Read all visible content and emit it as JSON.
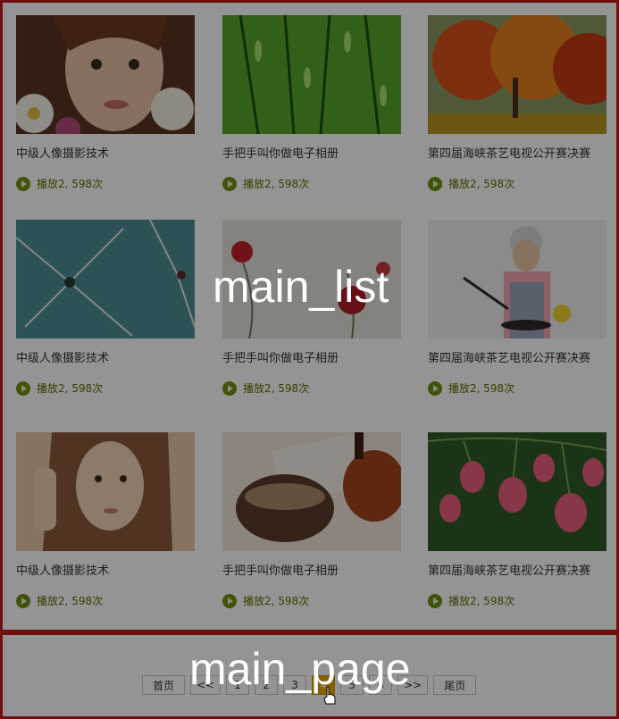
{
  "regions": {
    "list_label": "main_list",
    "page_label": "main_page"
  },
  "cards": [
    {
      "title": "中级人像摄影技术",
      "plays": "播放2, 598次",
      "thumb": "portrait-girl-flowers-photo"
    },
    {
      "title": "手把手叫你做电子相册",
      "plays": "播放2, 598次",
      "thumb": "willow-branches-photo"
    },
    {
      "title": "第四届海峡茶艺电视公开赛决赛",
      "plays": "播放2, 598次",
      "thumb": "autumn-trees-photo"
    },
    {
      "title": "中级人像摄影技术",
      "plays": "播放2, 598次",
      "thumb": "dandelion-photo"
    },
    {
      "title": "手把手叫你做电子相册",
      "plays": "播放2, 598次",
      "thumb": "red-poppies-photo"
    },
    {
      "title": "第四届海峡茶艺电视公开赛决赛",
      "plays": "播放2, 598次",
      "thumb": "grandmother-cooking-photo"
    },
    {
      "title": "中级人像摄影技术",
      "plays": "播放2, 598次",
      "thumb": "woman-portrait-photo"
    },
    {
      "title": "手把手叫你做电子相册",
      "plays": "播放2, 598次",
      "thumb": "teacup-photo"
    },
    {
      "title": "第四届海峡茶艺电视公开赛决赛",
      "plays": "播放2, 598次",
      "thumb": "pink-bellflowers-photo"
    }
  ],
  "pagination": {
    "first": "首页",
    "prev": "<<",
    "pages": [
      "1",
      "2",
      "3",
      "4",
      "5",
      "6",
      ">>"
    ],
    "active_page": "4",
    "last": "尾页"
  },
  "colors": {
    "region_border": "#c21b1b",
    "accent_active": "#e8a800",
    "play_icon": "#6d8f10"
  }
}
